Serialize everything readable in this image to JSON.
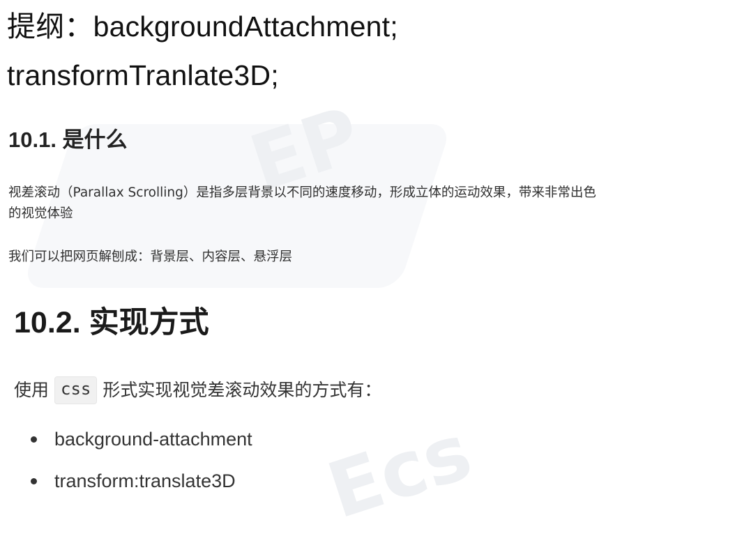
{
  "outline": {
    "line1": "提纲：backgroundAttachment;",
    "line2": "transformTranlate3D;"
  },
  "section_10_1": {
    "title": "10.1. 是什么",
    "paragraph1_line1": "视差滚动（Parallax Scrolling）是指多层背景以不同的速度移动，形成立体的运动效果，带来非常出色",
    "paragraph1_line2": "的视觉体验",
    "paragraph2": "我们可以把网页解刨成：背景层、内容层、悬浮层"
  },
  "section_10_2": {
    "title": "10.2. 实现方式",
    "usage_prefix": "使用",
    "usage_code": "css",
    "usage_suffix": "形式实现视觉差滚动效果的方式有：",
    "bullets": [
      "background-attachment",
      "transform:translate3D"
    ]
  },
  "watermark": {
    "top_text": "EP",
    "bottom_text": "Ecs"
  },
  "icons": {
    "bullet": "bullet-dot-icon"
  }
}
